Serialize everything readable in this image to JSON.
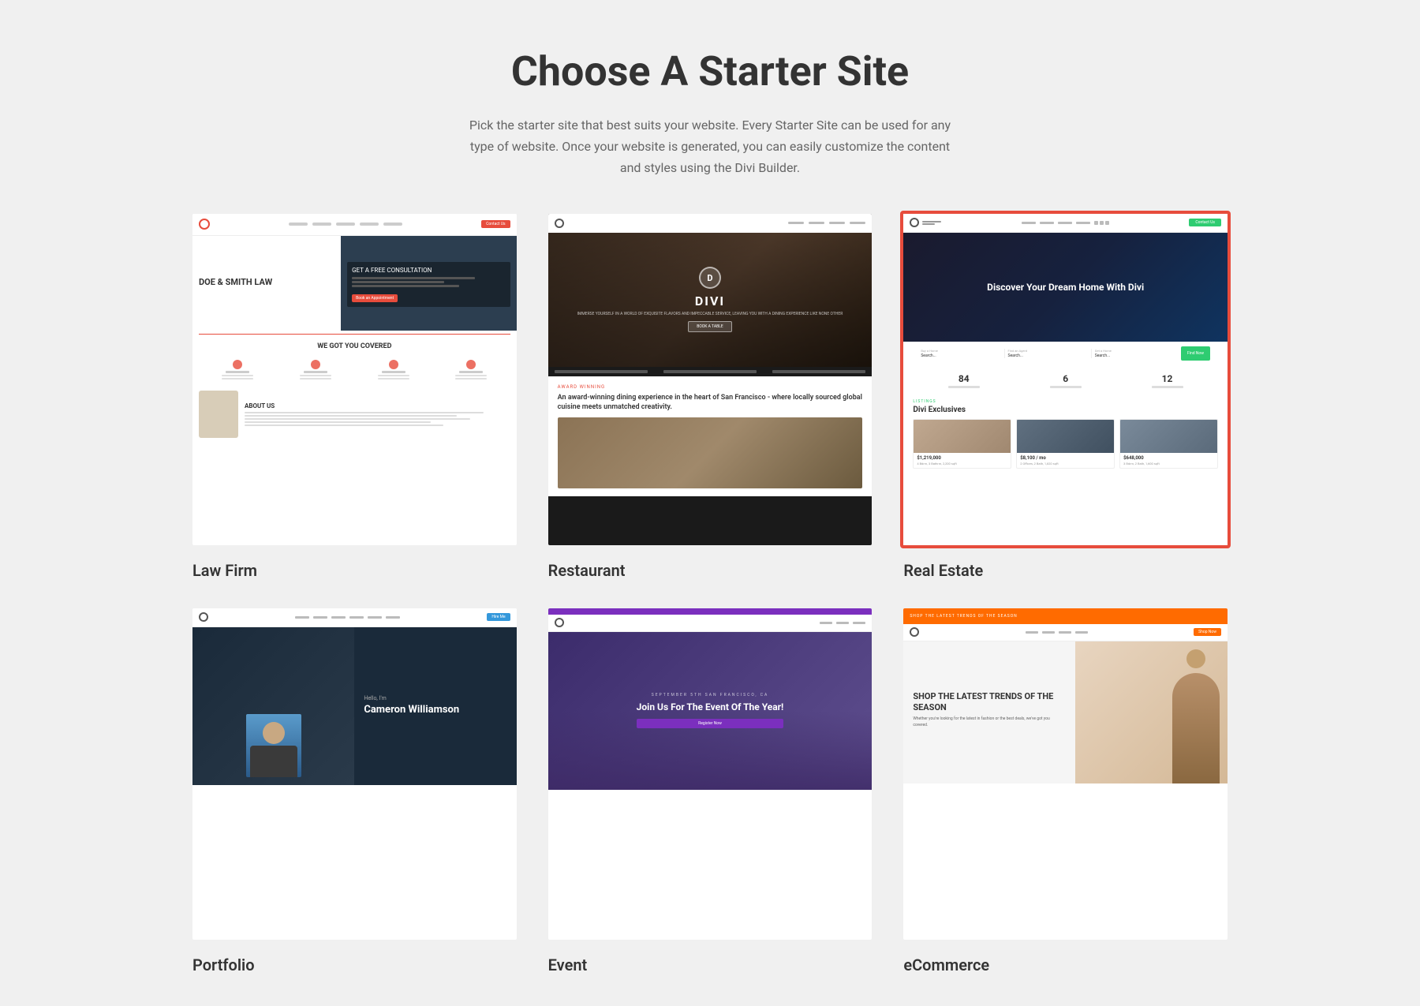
{
  "header": {
    "title": "Choose A Starter Site",
    "subtitle": "Pick the starter site that best suits your website. Every Starter Site can be used for any type of website. Once your website is generated, you can easily customize the content and styles using the Divi Builder."
  },
  "cards": [
    {
      "id": "law-firm",
      "label": "Law Firm",
      "selected": false,
      "preview_type": "law",
      "firm_name": "DOE & SMITH LAW",
      "hero_title": "GET A FREE CONSULTATION",
      "tagline": "WE GOT YOU COVERED",
      "about_title": "ABOUT US"
    },
    {
      "id": "restaurant",
      "label": "Restaurant",
      "selected": false,
      "preview_type": "restaurant",
      "brand": "DIVI",
      "desc_title": "An award-winning dining experience in the heart of San Francisco - where locally sourced global cuisine meets unmatched creativity."
    },
    {
      "id": "real-estate",
      "label": "Real Estate",
      "selected": true,
      "preview_type": "realestate",
      "hero_title": "Discover Your Dream Home With Divi",
      "excl_label": "LISTINGS",
      "excl_title": "Divi Exclusives",
      "stat1": "84",
      "stat2": "6",
      "stat3": "12",
      "card1_price": "$1,219,000",
      "card2_price": "$8,100 / mo",
      "card3_price": "$648,000"
    },
    {
      "id": "portfolio",
      "label": "Portfolio",
      "selected": false,
      "preview_type": "portfolio",
      "greeting": "Hello, I'm",
      "name": "Cameron Williamson"
    },
    {
      "id": "event",
      "label": "Event",
      "selected": false,
      "preview_type": "event",
      "label_text": "SEPTEMBER 5TH SAN FRANCISCO, CA",
      "title": "Join Us For The Event Of The Year!"
    },
    {
      "id": "ecommerce",
      "label": "eCommerce",
      "selected": false,
      "preview_type": "ecommerce",
      "top_text": "SHOP THE LATEST TRENDS OF THE SEASON",
      "hero_title": "SHOP THE LATEST TRENDS OF THE SEASON"
    }
  ],
  "colors": {
    "selected_border": "#e74c3c",
    "bg": "#f0f0f0",
    "accent_green": "#2ecc71",
    "accent_orange": "#ff6b00",
    "accent_purple": "#7b2fbe"
  }
}
